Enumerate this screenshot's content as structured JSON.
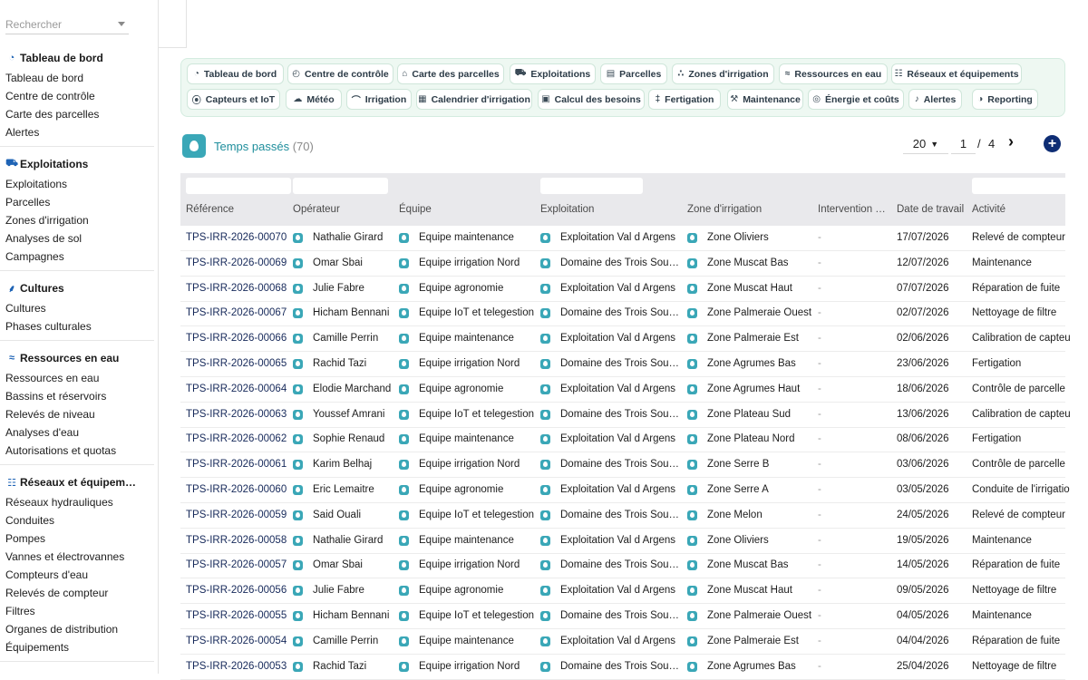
{
  "search": {
    "placeholder": "Rechercher"
  },
  "sidebar": {
    "sections": [
      {
        "title": "Tableau de bord",
        "icon": "dashboard-icon",
        "items": [
          "Tableau de bord",
          "Centre de contrôle",
          "Carte des parcelles",
          "Alertes"
        ]
      },
      {
        "title": "Exploitations",
        "icon": "tractor-icon",
        "items": [
          "Exploitations",
          "Parcelles",
          "Zones d'irrigation",
          "Analyses de sol",
          "Campagnes"
        ]
      },
      {
        "title": "Cultures",
        "icon": "sprout-icon",
        "items": [
          "Cultures",
          "Phases culturales"
        ]
      },
      {
        "title": "Ressources en eau",
        "icon": "water-icon",
        "items": [
          "Ressources en eau",
          "Bassins et réservoirs",
          "Relevés de niveau",
          "Analyses d'eau",
          "Autorisations et quotas"
        ]
      },
      {
        "title": "Réseaux et équipem…",
        "icon": "network-icon",
        "items": [
          "Réseaux hydrauliques",
          "Conduites",
          "Pompes",
          "Vannes et électrovannes",
          "Compteurs d'eau",
          "Relevés de compteur",
          "Filtres",
          "Organes de distribution",
          "Équipements"
        ]
      },
      {
        "title": "Capteurs et IoT",
        "icon": "sensor-icon",
        "items": []
      }
    ]
  },
  "nav": {
    "chips": [
      {
        "label": "Tableau de bord",
        "icon": "dashboard-icon"
      },
      {
        "label": "Centre de contrôle",
        "icon": "satellite-icon"
      },
      {
        "label": "Carte des parcelles",
        "icon": "map-pin-icon"
      },
      {
        "label": "Exploitations",
        "icon": "tractor-icon"
      },
      {
        "label": "Parcelles",
        "icon": "map-icon"
      },
      {
        "label": "Zones d'irrigation",
        "icon": "sitemap-icon"
      },
      {
        "label": "Ressources en eau",
        "icon": "water-icon"
      },
      {
        "label": "Réseaux et équipements",
        "icon": "network-icon"
      },
      {
        "label": "Capteurs et IoT",
        "icon": "sensor-icon"
      },
      {
        "label": "Météo",
        "icon": "cloud-icon"
      },
      {
        "label": "Irrigation",
        "icon": "faucet-icon"
      },
      {
        "label": "Calendrier d'irrigation",
        "icon": "calendar-icon"
      },
      {
        "label": "Calcul des besoins",
        "icon": "calculator-icon"
      },
      {
        "label": "Fertigation",
        "icon": "flask-icon"
      },
      {
        "label": "Maintenance",
        "icon": "wrench-icon"
      },
      {
        "label": "Énergie et coûts",
        "icon": "coins-icon"
      },
      {
        "label": "Alertes",
        "icon": "bell-icon"
      },
      {
        "label": "Reporting",
        "icon": "chart-pie-icon"
      }
    ]
  },
  "header": {
    "title": "Temps passés",
    "count": "(70)"
  },
  "pager": {
    "page_size": "20",
    "page": "1",
    "separator": "/",
    "total_pages": "4"
  },
  "table": {
    "columns": [
      "Référence",
      "Opérateur",
      "Équipe",
      "Exploitation",
      "Zone d'irrigation",
      "Intervention …",
      "Date de travail",
      "Activité"
    ],
    "rows": [
      [
        "TPS-IRR-2026-00070",
        "Nathalie Girard",
        "Equipe maintenance",
        "Exploitation Val d Argens",
        "Zone Oliviers",
        "-",
        "17/07/2026",
        "Relevé de compteur"
      ],
      [
        "TPS-IRR-2026-00069",
        "Omar Sbai",
        "Equipe irrigation Nord",
        "Domaine des Trois Sou…",
        "Zone Muscat Bas",
        "-",
        "12/07/2026",
        "Maintenance"
      ],
      [
        "TPS-IRR-2026-00068",
        "Julie Fabre",
        "Equipe agronomie",
        "Exploitation Val d Argens",
        "Zone Muscat Haut",
        "-",
        "07/07/2026",
        "Réparation de fuite"
      ],
      [
        "TPS-IRR-2026-00067",
        "Hicham Bennani",
        "Equipe IoT et telegestion",
        "Domaine des Trois Sou…",
        "Zone Palmeraie Ouest",
        "-",
        "02/07/2026",
        "Nettoyage de filtre"
      ],
      [
        "TPS-IRR-2026-00066",
        "Camille Perrin",
        "Equipe maintenance",
        "Exploitation Val d Argens",
        "Zone Palmeraie Est",
        "-",
        "02/06/2026",
        "Calibration de capteu"
      ],
      [
        "TPS-IRR-2026-00065",
        "Rachid Tazi",
        "Equipe irrigation Nord",
        "Domaine des Trois Sou…",
        "Zone Agrumes Bas",
        "-",
        "23/06/2026",
        "Fertigation"
      ],
      [
        "TPS-IRR-2026-00064",
        "Elodie Marchand",
        "Equipe agronomie",
        "Exploitation Val d Argens",
        "Zone Agrumes Haut",
        "-",
        "18/06/2026",
        "Contrôle de parcelle"
      ],
      [
        "TPS-IRR-2026-00063",
        "Youssef Amrani",
        "Equipe IoT et telegestion",
        "Domaine des Trois Sou…",
        "Zone Plateau Sud",
        "-",
        "13/06/2026",
        "Calibration de capteu"
      ],
      [
        "TPS-IRR-2026-00062",
        "Sophie Renaud",
        "Equipe maintenance",
        "Exploitation Val d Argens",
        "Zone Plateau Nord",
        "-",
        "08/06/2026",
        "Fertigation"
      ],
      [
        "TPS-IRR-2026-00061",
        "Karim Belhaj",
        "Equipe irrigation Nord",
        "Domaine des Trois Sou…",
        "Zone Serre B",
        "-",
        "03/06/2026",
        "Contrôle de parcelle"
      ],
      [
        "TPS-IRR-2026-00060",
        "Eric Lemaitre",
        "Equipe agronomie",
        "Exploitation Val d Argens",
        "Zone Serre A",
        "-",
        "03/05/2026",
        "Conduite de l'irrigatio"
      ],
      [
        "TPS-IRR-2026-00059",
        "Said Ouali",
        "Equipe IoT et telegestion",
        "Domaine des Trois Sou…",
        "Zone Melon",
        "-",
        "24/05/2026",
        "Relevé de compteur"
      ],
      [
        "TPS-IRR-2026-00058",
        "Nathalie Girard",
        "Equipe maintenance",
        "Exploitation Val d Argens",
        "Zone Oliviers",
        "-",
        "19/05/2026",
        "Maintenance"
      ],
      [
        "TPS-IRR-2026-00057",
        "Omar Sbai",
        "Equipe irrigation Nord",
        "Domaine des Trois Sou…",
        "Zone Muscat Bas",
        "-",
        "14/05/2026",
        "Réparation de fuite"
      ],
      [
        "TPS-IRR-2026-00056",
        "Julie Fabre",
        "Equipe agronomie",
        "Exploitation Val d Argens",
        "Zone Muscat Haut",
        "-",
        "09/05/2026",
        "Nettoyage de filtre"
      ],
      [
        "TPS-IRR-2026-00055",
        "Hicham Bennani",
        "Equipe IoT et telegestion",
        "Domaine des Trois Sou…",
        "Zone Palmeraie Ouest",
        "-",
        "04/05/2026",
        "Maintenance"
      ],
      [
        "TPS-IRR-2026-00054",
        "Camille Perrin",
        "Equipe maintenance",
        "Exploitation Val d Argens",
        "Zone Palmeraie Est",
        "-",
        "04/04/2026",
        "Réparation de fuite"
      ],
      [
        "TPS-IRR-2026-00053",
        "Rachid Tazi",
        "Equipe irrigation Nord",
        "Domaine des Trois Sou…",
        "Zone Agrumes Bas",
        "-",
        "25/04/2026",
        "Nettoyage de filtre"
      ]
    ]
  },
  "colors": {
    "accent": "#1f8e9c",
    "badge": "#3aa7b7",
    "add_button": "#0e2d74",
    "nav_bg": "#eef8f2"
  }
}
